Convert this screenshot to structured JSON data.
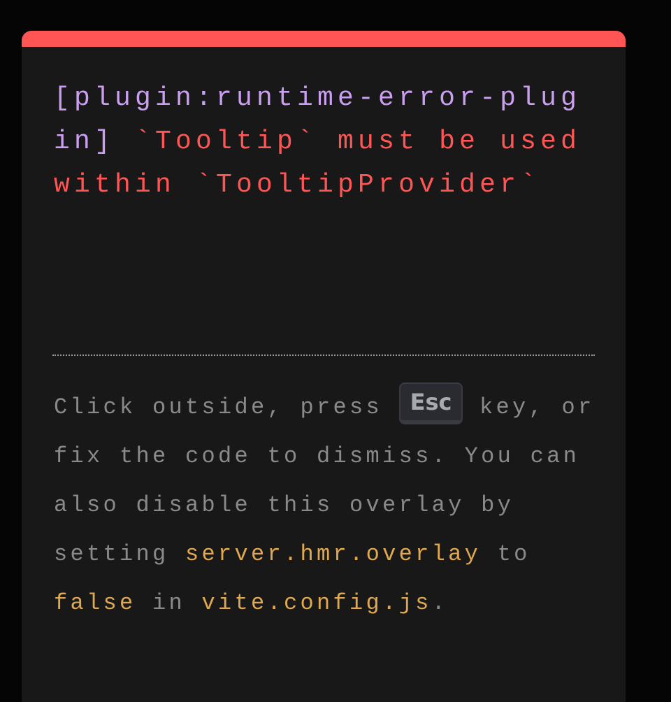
{
  "error": {
    "plugin": "[plugin:runtime-error-plugin]",
    "message": " `Tooltip` must be used within `TooltipProvider`"
  },
  "tip": {
    "part1": "Click outside, press ",
    "key": "Esc",
    "part2": " key, or fix the code to dismiss. You can also disable this overlay by setting ",
    "setting": "server.hmr.overlay",
    "part3": " to ",
    "value": "false",
    "part4": " in ",
    "file": "vite.config.js",
    "part5": "."
  },
  "colors": {
    "accent": "#ff5555",
    "plugin": "#cb9ff0",
    "highlight": "#e0a84f",
    "text": "#8a8a8a",
    "background": "#181818"
  }
}
